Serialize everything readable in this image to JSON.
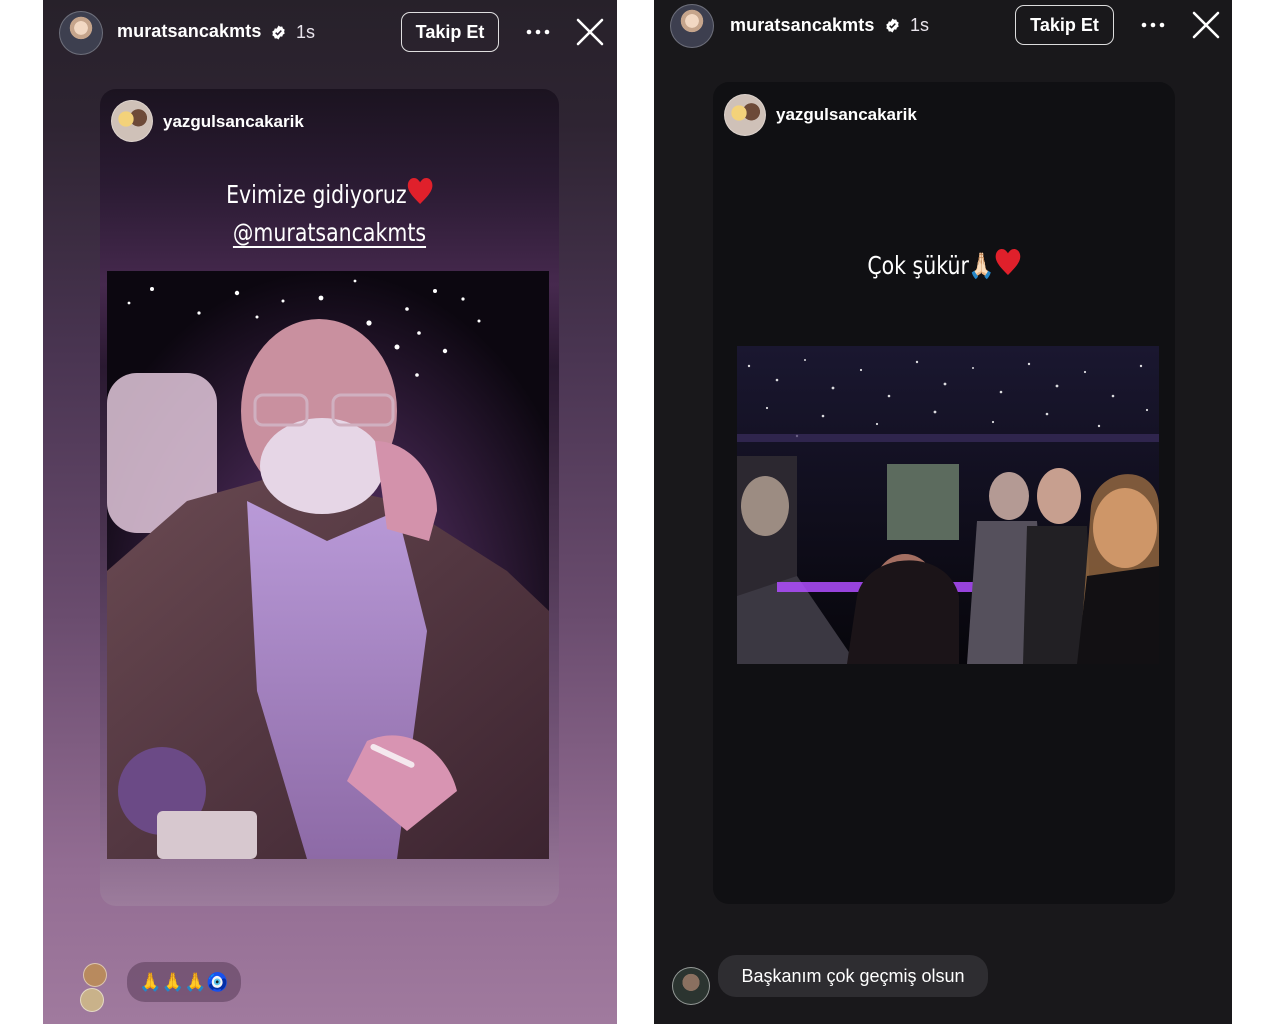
{
  "left_story": {
    "owner": {
      "username": "muratsancakmts",
      "time": "1s",
      "avatar_icon": "profile-avatar-icon",
      "verified_icon": "verified-badge-icon"
    },
    "follow_label": "Takip Et",
    "more_icon": "ellipsis-icon",
    "close_icon": "close-icon",
    "shared_post": {
      "username": "yazgulsancakarik",
      "caption_line1": "Evimize gidiyoruz",
      "caption_mention": "@muratsancakmts",
      "caption_emoji": "heart-icon",
      "photo_description_icon": "photo-man-on-phone"
    },
    "reply": {
      "text": "🙏🙏🙏🧿"
    }
  },
  "right_story": {
    "owner": {
      "username": "muratsancakmts",
      "time": "1s",
      "avatar_icon": "profile-avatar-icon",
      "verified_icon": "verified-badge-icon"
    },
    "follow_label": "Takip Et",
    "more_icon": "ellipsis-icon",
    "close_icon": "close-icon",
    "shared_post": {
      "username": "yazgulsancakarik",
      "caption": "Çok şükür🙏🏻",
      "caption_emoji": "heart-icon",
      "photo_description_icon": "photo-group-selfie"
    },
    "reply": {
      "text": "Başkanım çok geçmiş olsun"
    }
  },
  "colors": {
    "left_gradient_top": "#27212a",
    "left_gradient_bottom": "#a07a9e",
    "right_background": "#19181b",
    "heart": "#e0202b",
    "accent_purple": "#b04dff"
  }
}
